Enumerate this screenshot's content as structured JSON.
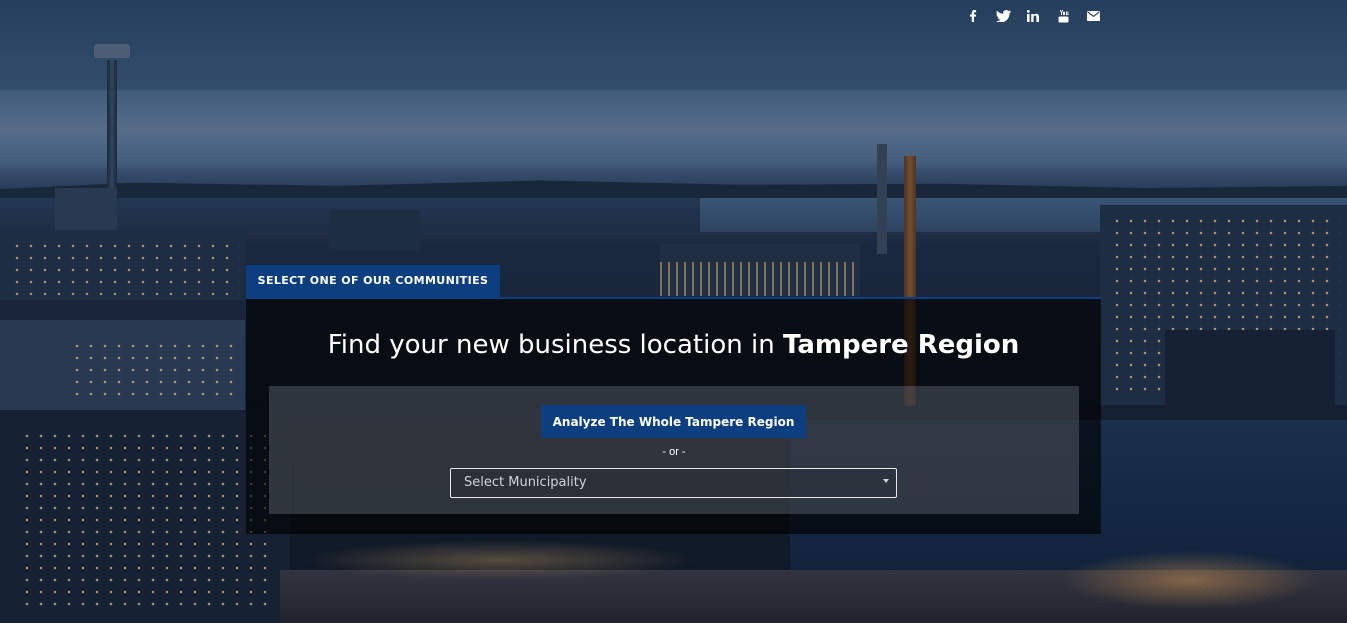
{
  "social": [
    {
      "name": "facebook-icon"
    },
    {
      "name": "twitter-icon"
    },
    {
      "name": "linkedin-icon"
    },
    {
      "name": "youtube-icon"
    },
    {
      "name": "email-icon"
    }
  ],
  "tab_label": "SELECT ONE OF OUR COMMUNITIES",
  "headline": {
    "prefix": "Find your new business location in ",
    "emphasis": "Tampere Region"
  },
  "analyze_button": "Analyze The Whole Tampere Region",
  "separator": "- or -",
  "municipality_select": {
    "placeholder": "Select Municipality"
  },
  "colors": {
    "accent": "#0d3f80",
    "panel": "rgba(0,0,0,0.62)",
    "text": "#ffffff"
  }
}
